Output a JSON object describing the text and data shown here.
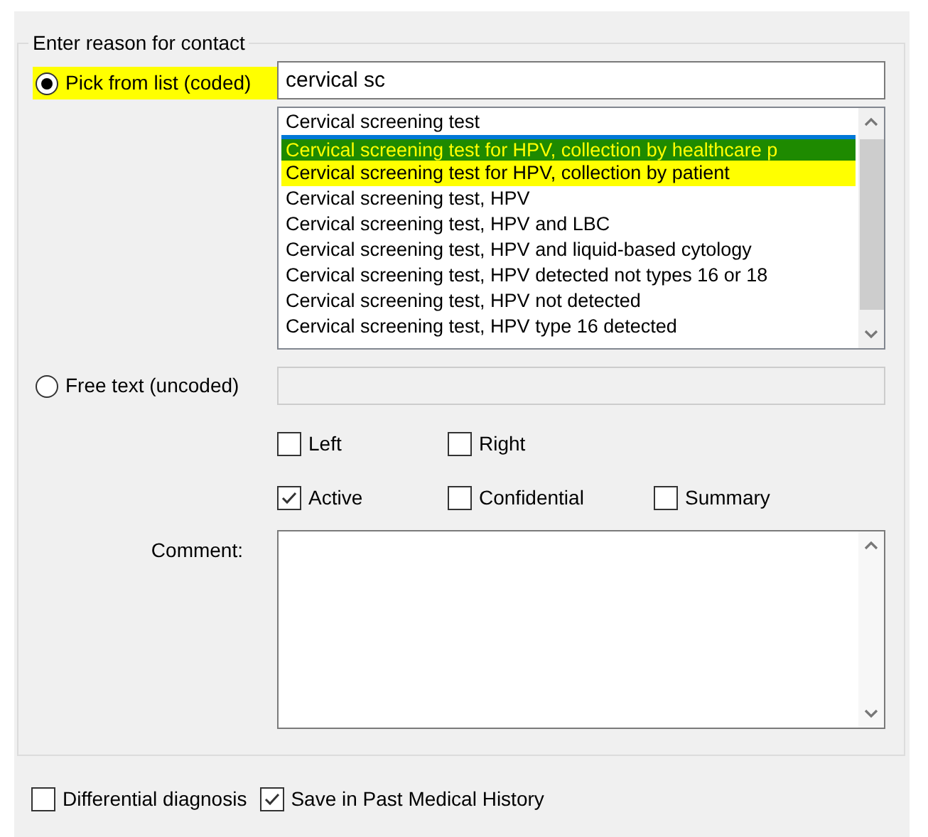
{
  "group": {
    "title": "Enter reason for contact"
  },
  "coded": {
    "label": "Pick from list (coded)",
    "selected": true,
    "highlighted": true,
    "value": "cervical sc"
  },
  "results": [
    {
      "text": "Cervical screening test",
      "selected": false,
      "highlighted": false
    },
    {
      "text": "Cervical screening test for HPV, collection by healthcare p",
      "selected": true,
      "highlighted": true
    },
    {
      "text": "Cervical screening test for HPV, collection by patient",
      "selected": false,
      "highlighted": true
    },
    {
      "text": "Cervical screening test, HPV",
      "selected": false,
      "highlighted": false
    },
    {
      "text": "Cervical screening test, HPV and LBC",
      "selected": false,
      "highlighted": false
    },
    {
      "text": "Cervical screening test, HPV and liquid-based cytology",
      "selected": false,
      "highlighted": false
    },
    {
      "text": "Cervical screening test, HPV detected not types 16 or 18",
      "selected": false,
      "highlighted": false
    },
    {
      "text": "Cervical screening test, HPV not detected",
      "selected": false,
      "highlighted": false
    },
    {
      "text": "Cervical screening test, HPV type 16 detected",
      "selected": false,
      "highlighted": false
    }
  ],
  "uncoded": {
    "label": "Free text (uncoded)",
    "selected": false,
    "highlighted": false,
    "disabled": true
  },
  "option_rows": [
    [
      {
        "label": "Left",
        "checked": false
      },
      {
        "label": "Right",
        "checked": false
      }
    ],
    [
      {
        "label": "Active",
        "checked": true
      },
      {
        "label": "Confidential",
        "checked": false
      },
      {
        "label": "Summary",
        "checked": false
      }
    ]
  ],
  "comment": {
    "label": "Comment:"
  },
  "footer": [
    {
      "label": "Differential diagnosis",
      "checked": false
    },
    {
      "label": "Save in Past Medical History",
      "checked": true
    }
  ]
}
